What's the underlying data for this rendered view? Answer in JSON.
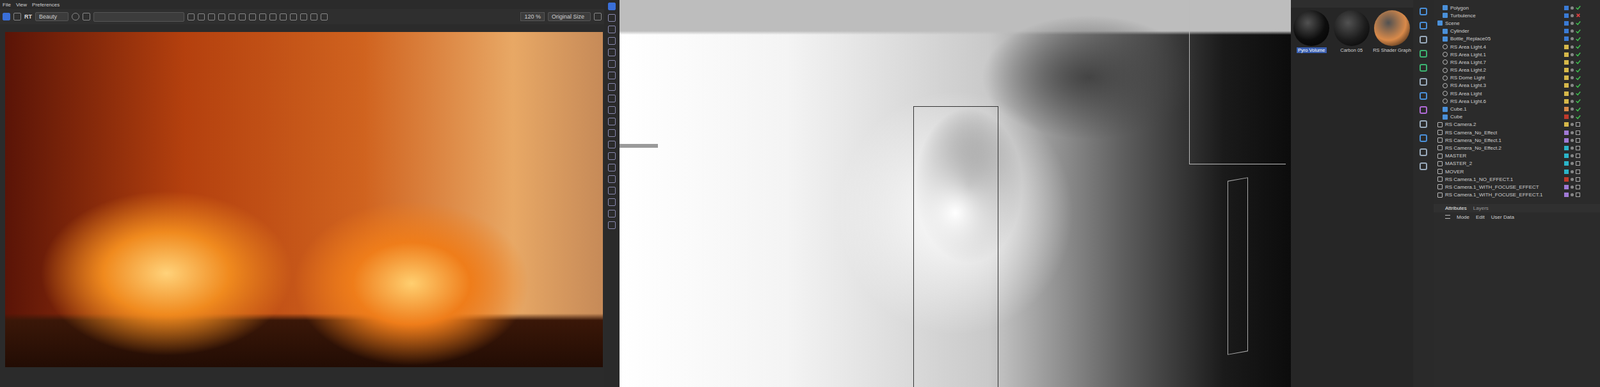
{
  "menu": [
    "File",
    "View",
    "Preferences"
  ],
  "render_toolbar": {
    "aov": "Beauty",
    "mode": "RT",
    "zoom": "120 %",
    "size": "Original Size"
  },
  "materials": [
    {
      "name": "Pyro Volume",
      "selected": true,
      "color": "#0d0d0d"
    },
    {
      "name": "Carbon 05",
      "selected": false,
      "color": "#1c1c1c"
    },
    {
      "name": "RS Shader Graph",
      "selected": false,
      "color": "#d98a4a"
    }
  ],
  "objects": [
    {
      "name": "Polygon",
      "depth": 1,
      "kind": "object",
      "enabled": true,
      "color": "#3a7bd5"
    },
    {
      "name": "Turbulence",
      "depth": 1,
      "kind": "object",
      "enabled": false,
      "color": "#3a7bd5"
    },
    {
      "name": "Scene",
      "depth": 0,
      "kind": "object",
      "enabled": true,
      "color": "#3a7bd5"
    },
    {
      "name": "Cylinder",
      "depth": 1,
      "kind": "object",
      "enabled": true,
      "color": "#3a7bd5"
    },
    {
      "name": "Bottle_Replace05",
      "depth": 1,
      "kind": "object",
      "enabled": true,
      "color": "#3a7bd5"
    },
    {
      "name": "RS Area Light.4",
      "depth": 1,
      "kind": "light",
      "enabled": true,
      "color": "#d6b84a"
    },
    {
      "name": "RS Area Light.1",
      "depth": 1,
      "kind": "light",
      "enabled": true,
      "color": "#d6b84a"
    },
    {
      "name": "RS Area Light.7",
      "depth": 1,
      "kind": "light",
      "enabled": true,
      "color": "#d6b84a"
    },
    {
      "name": "RS Area Light.2",
      "depth": 1,
      "kind": "light",
      "enabled": true,
      "color": "#d6b84a"
    },
    {
      "name": "RS Dome Light",
      "depth": 1,
      "kind": "light",
      "enabled": true,
      "color": "#d6b84a"
    },
    {
      "name": "RS Area Light.3",
      "depth": 1,
      "kind": "light",
      "enabled": true,
      "color": "#d6b84a"
    },
    {
      "name": "RS Area Light",
      "depth": 1,
      "kind": "light",
      "enabled": true,
      "color": "#d6b84a"
    },
    {
      "name": "RS Area Light.6",
      "depth": 1,
      "kind": "light",
      "enabled": true,
      "color": "#d6b84a"
    },
    {
      "name": "Cube.1",
      "depth": 1,
      "kind": "object",
      "enabled": true,
      "color": "#d98a4a"
    },
    {
      "name": "Cube",
      "depth": 1,
      "kind": "object",
      "enabled": true,
      "color": "#c0392b"
    },
    {
      "name": "RS Camera.2",
      "depth": 0,
      "kind": "camera",
      "enabled": true,
      "color": "#d6b84a"
    },
    {
      "name": "RS Camera_No_Effect",
      "depth": 0,
      "kind": "camera",
      "enabled": true,
      "color": "#a07ad6"
    },
    {
      "name": "RS Camera_No_Effect.1",
      "depth": 0,
      "kind": "camera",
      "enabled": true,
      "color": "#a07ad6"
    },
    {
      "name": "RS Camera_No_Effect.2",
      "depth": 0,
      "kind": "camera",
      "enabled": true,
      "color": "#2bb5c9"
    },
    {
      "name": "MASTER",
      "depth": 0,
      "kind": "camera",
      "enabled": true,
      "color": "#2bb5c9"
    },
    {
      "name": "MASTER_2",
      "depth": 0,
      "kind": "camera",
      "enabled": true,
      "color": "#2bb5c9"
    },
    {
      "name": "MOVER",
      "depth": 0,
      "kind": "camera",
      "enabled": true,
      "color": "#2bb5c9"
    },
    {
      "name": "RS Camera.1_NO_EFFECT.1",
      "depth": 0,
      "kind": "camera",
      "enabled": true,
      "color": "#c0392b"
    },
    {
      "name": "RS Camera.1_WITH_FOCUSE_EFFECT",
      "depth": 0,
      "kind": "camera",
      "enabled": true,
      "color": "#a07ad6"
    },
    {
      "name": "RS Camera.1_WITH_FOCUSE_EFFECT.1",
      "depth": 0,
      "kind": "camera",
      "enabled": true,
      "color": "#a07ad6"
    }
  ],
  "attributes": {
    "tabs": [
      {
        "label": "Attributes",
        "selected": true
      },
      {
        "label": "Layers",
        "selected": false
      }
    ],
    "menu": [
      "Mode",
      "Edit",
      "User Data"
    ]
  }
}
